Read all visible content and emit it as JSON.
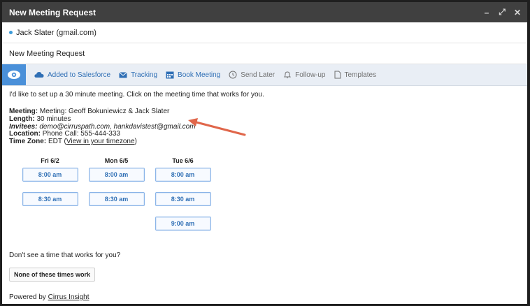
{
  "window": {
    "title": "New Meeting Request"
  },
  "controls": {
    "minimize": "–",
    "expand": "⤢",
    "close": "✕"
  },
  "to": {
    "recipient": "Jack Slater (gmail.com)"
  },
  "subject": "New Meeting Request",
  "toolbar": {
    "items": [
      {
        "label": "Added to Salesforce",
        "icon": "cloud-icon"
      },
      {
        "label": "Tracking",
        "icon": "envelope-icon"
      },
      {
        "label": "Book Meeting",
        "icon": "calendar-icon"
      },
      {
        "label": "Send Later",
        "icon": "clock-icon"
      },
      {
        "label": "Follow-up",
        "icon": "bell-icon"
      },
      {
        "label": "Templates",
        "icon": "document-icon"
      }
    ]
  },
  "body": {
    "intro": "I'd like to set up a 30 minute meeting. Click on the meeting time that works for you.",
    "meeting_label": "Meeting:",
    "meeting_value": "Meeting: Geoff Bokuniewicz & Jack Slater",
    "length_label": "Length:",
    "length_value": "30 minutes",
    "invitees_label": "Invitees:",
    "invitees_value": "demo@cirruspath.com, hankdavistest@gmail.com",
    "location_label": "Location:",
    "location_value": "Phone Call: 555-444-333",
    "timezone_label": "Time Zone:",
    "timezone_value": "EDT (",
    "timezone_link": "View in your timezone",
    "timezone_close": ")"
  },
  "slots": [
    {
      "day": "Fri 6/2",
      "times": [
        "8:00 am",
        "8:30 am"
      ]
    },
    {
      "day": "Mon 6/5",
      "times": [
        "8:00 am",
        "8:30 am"
      ]
    },
    {
      "day": "Tue 6/6",
      "times": [
        "8:00 am",
        "8:30 am",
        "9:00 am"
      ]
    }
  ],
  "footer": {
    "no_time": "Don't see a time that works for you?",
    "none_button": "None of these times work",
    "powered_by": "Powered by ",
    "powered_link": "Cirrus Insight"
  },
  "colors": {
    "accent": "#4a90d9",
    "arrow": "#e0664a",
    "titlebar": "#404040"
  }
}
